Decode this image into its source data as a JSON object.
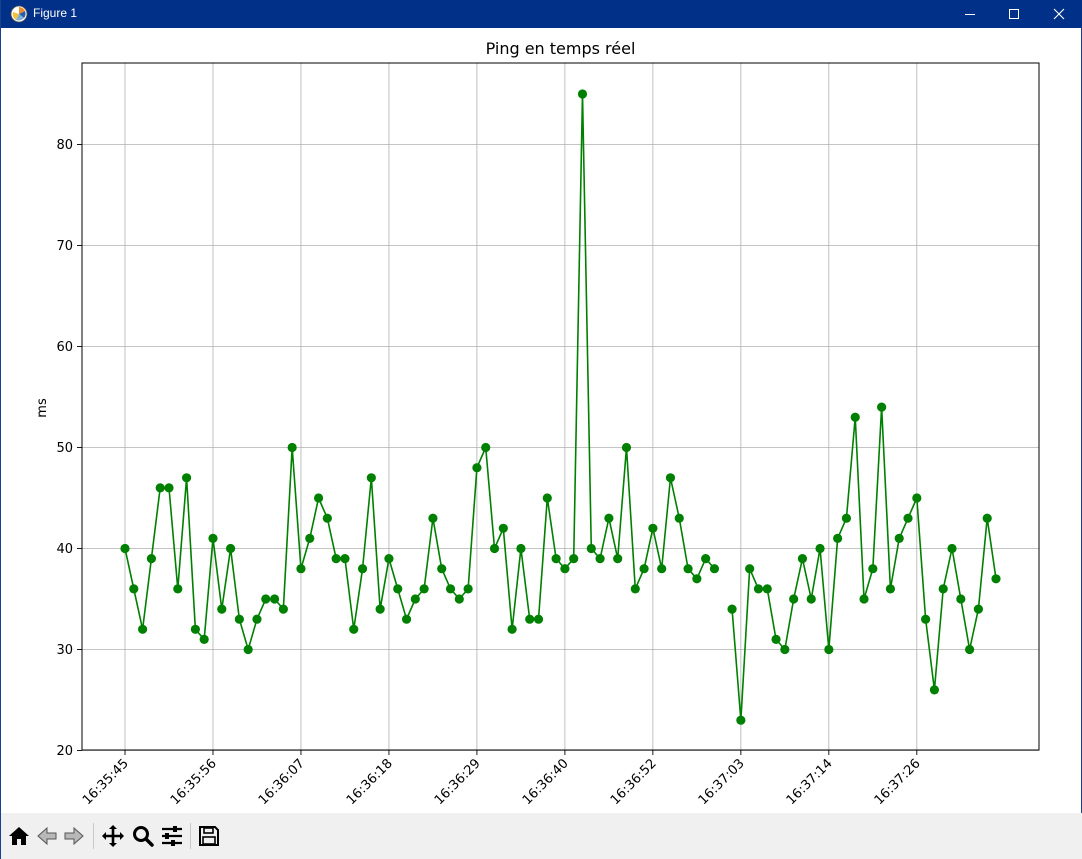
{
  "window": {
    "title": "Figure 1"
  },
  "toolbar": {
    "buttons": [
      "home-icon",
      "back-icon",
      "forward-icon",
      "pan-icon",
      "zoom-icon",
      "configure-icon",
      "save-icon"
    ]
  },
  "colors": {
    "line": "#008000",
    "titlebar": "#003087",
    "grid": "#b0b0b0"
  },
  "chart_data": {
    "type": "line",
    "title": "Ping en temps réel",
    "xlabel": "",
    "ylabel": "ms",
    "ylim": [
      20,
      88
    ],
    "yticks": [
      20,
      30,
      40,
      50,
      60,
      70,
      80
    ],
    "xtick_labels": [
      "16:35:45",
      "16:35:56",
      "16:36:07",
      "16:36:18",
      "16:36:29",
      "16:36:40",
      "16:36:52",
      "16:37:03",
      "16:37:14",
      "16:37:26"
    ],
    "xtick_index": [
      0,
      10,
      20,
      30,
      40,
      50,
      60,
      70,
      80,
      90
    ],
    "grid": true,
    "marker": "circle",
    "series": [
      {
        "values": [
          40,
          36,
          32,
          39,
          46,
          46,
          36,
          47,
          32,
          31,
          41,
          34,
          40,
          33,
          30,
          33,
          35,
          35,
          34,
          50,
          38,
          41,
          45,
          43,
          39,
          39,
          32,
          38,
          47,
          34,
          39,
          36,
          33,
          35,
          36,
          43,
          38,
          36,
          35,
          36,
          48,
          50,
          40,
          42,
          32,
          40,
          33,
          33,
          45,
          39,
          38,
          39,
          85,
          40,
          39,
          43,
          39,
          50,
          36,
          38,
          42,
          38,
          47,
          43,
          38,
          37,
          39,
          38,
          null,
          34,
          23,
          38,
          36,
          36,
          31,
          30,
          35,
          39,
          35,
          40,
          30,
          41,
          43,
          53,
          35,
          38,
          54,
          36,
          41,
          43,
          45,
          33,
          26,
          36,
          40,
          35,
          30,
          34,
          43,
          37
        ]
      }
    ]
  }
}
